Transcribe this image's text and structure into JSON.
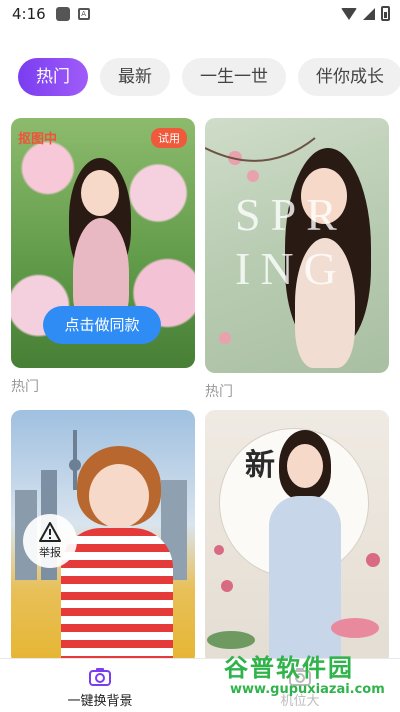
{
  "status_bar": {
    "time": "4:16"
  },
  "tabs": [
    {
      "label": "热门",
      "active": true
    },
    {
      "label": "最新",
      "active": false
    },
    {
      "label": "一生一世",
      "active": false
    },
    {
      "label": "伴你成长",
      "active": false
    }
  ],
  "cards": [
    {
      "caption": "热门",
      "corner_tag": "抠图中",
      "trial_badge": "试用",
      "cta": "点击做同款"
    },
    {
      "caption": "热门",
      "overlay_text": "SPRING"
    },
    {
      "report_label": "举报"
    },
    {
      "title_art": "新"
    }
  ],
  "bottom_nav": {
    "items": [
      {
        "label": "一键换背景",
        "icon": "camera-icon"
      },
      {
        "label": "机位大",
        "icon": "camera-icon"
      }
    ]
  },
  "watermark": {
    "brand": "谷普软件园",
    "url": "www.gupuxiazai.com"
  },
  "colors": {
    "accent": "#8a4cf5",
    "cta_blue": "#2f8cf5",
    "trial_red": "#f05a3c",
    "watermark_green": "#2fb34a"
  }
}
